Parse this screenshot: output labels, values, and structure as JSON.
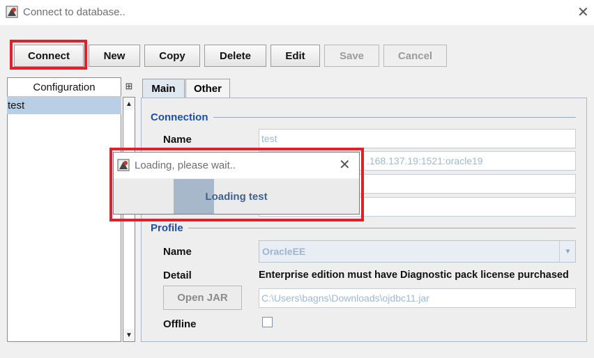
{
  "window": {
    "title": "Connect to database..",
    "app_icon": "app-icon",
    "close_icon": "close-icon"
  },
  "toolbar": {
    "connect": "Connect",
    "new": "New",
    "copy": "Copy",
    "delete": "Delete",
    "edit": "Edit",
    "save": "Save",
    "cancel": "Cancel"
  },
  "config_list": {
    "header": "Configuration",
    "items": [
      "test"
    ],
    "selected": "test"
  },
  "tabs": [
    "Main",
    "Other"
  ],
  "active_tab": "Main",
  "connection": {
    "section": "Connection",
    "name_label": "Name",
    "name_value": "test",
    "url_value": ".168.137.19:1521:oracle19",
    "user_value": "",
    "password_value": ""
  },
  "profile": {
    "section": "Profile",
    "name_label": "Name",
    "name_value": "OracleEE",
    "detail_label": "Detail",
    "detail_value": "Enterprise edition must have Diagnostic pack license purchased",
    "open_jar_label": "Open JAR",
    "jar_path": "C:\\Users\\bagns\\Downloads\\ojdbc11.jar",
    "offline_label": "Offline",
    "offline_checked": false
  },
  "loading_dialog": {
    "title": "Loading, please wait..",
    "message": "Loading test"
  },
  "colors": {
    "highlight": "#e0202a",
    "section_title": "#1d4ea5",
    "selection": "#b8cfe5"
  }
}
